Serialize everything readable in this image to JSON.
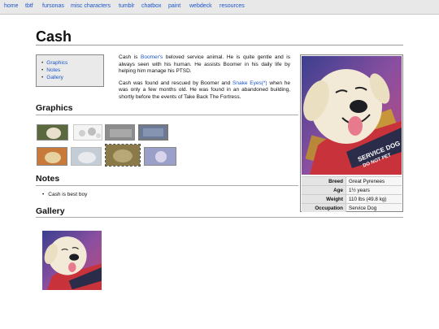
{
  "nav": [
    "home",
    "tbtf",
    "fursonas",
    "misc characters",
    "tumblr",
    "chatbox",
    "paint",
    "webdeck",
    "resources"
  ],
  "page": {
    "title": "Cash"
  },
  "toc": [
    "Graphics",
    "Notes",
    "Gallery"
  ],
  "intro": {
    "p1_pre": "Cash is ",
    "p1_link": "Boomer's",
    "p1_post": " beloved service animal. He is quite gentle and is always seen with his human. He assists Boomer in his daily life by helping him manage his PTSD.",
    "p2_pre": "Cash was found and rescued by Boomer and ",
    "p2_link": "Snake Eyes(*)",
    "p2_post": " when he was only a few months old. He was found in an abandoned building, shortly before the events of Take Back The Fortress."
  },
  "infobox": {
    "rows": [
      {
        "key": "Breed",
        "value": "Great Pyrenees"
      },
      {
        "key": "Age",
        "value": "1½ years"
      },
      {
        "key": "Weight",
        "value": "110 lbs (49.8 kg)"
      },
      {
        "key": "Occupation",
        "value": "Service Dog"
      }
    ],
    "vest_text_1": "SERVICE DOG",
    "vest_text_2": "DO NOT PET"
  },
  "sections": {
    "graphics": "Graphics",
    "notes": "Notes",
    "gallery": "Gallery"
  },
  "notes": [
    "Cash is best boy"
  ],
  "colors": {
    "link": "#1a55cc",
    "vest": "#c8323a",
    "bg_purple": "#6a4f9c"
  }
}
